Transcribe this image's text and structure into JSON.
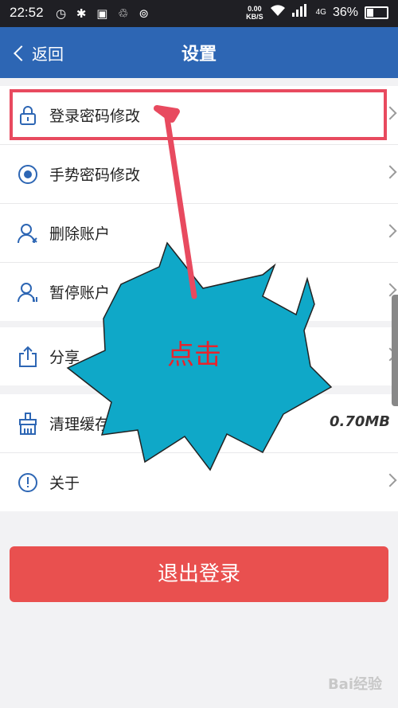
{
  "status_bar": {
    "time": "22:52",
    "network_speed_value": "0.00",
    "network_speed_unit": "KB/S",
    "network_type": "4G",
    "battery": "36%"
  },
  "nav": {
    "back_label": "返回",
    "title": "设置"
  },
  "settings": {
    "group1": [
      {
        "label": "登录密码修改",
        "icon": "lock-icon"
      },
      {
        "label": "手势密码修改",
        "icon": "gesture-icon"
      },
      {
        "label": "删除账户",
        "icon": "user-delete-icon"
      },
      {
        "label": "暂停账户",
        "icon": "user-pause-icon"
      }
    ],
    "group2": [
      {
        "label": "分享",
        "icon": "share-icon"
      }
    ],
    "group3": [
      {
        "label": "清理缓存",
        "icon": "brush-icon",
        "value": "0.70MB"
      },
      {
        "label": "关于",
        "icon": "info-icon"
      }
    ]
  },
  "logout_label": "退出登录",
  "annotation": {
    "callout_text": "点击"
  },
  "watermark": "Bai经验",
  "colors": {
    "nav_bg": "#2d66b4",
    "highlight": "#e84a5f",
    "callout_fill": "#0fa8c8",
    "logout_bg": "#e9504f"
  }
}
